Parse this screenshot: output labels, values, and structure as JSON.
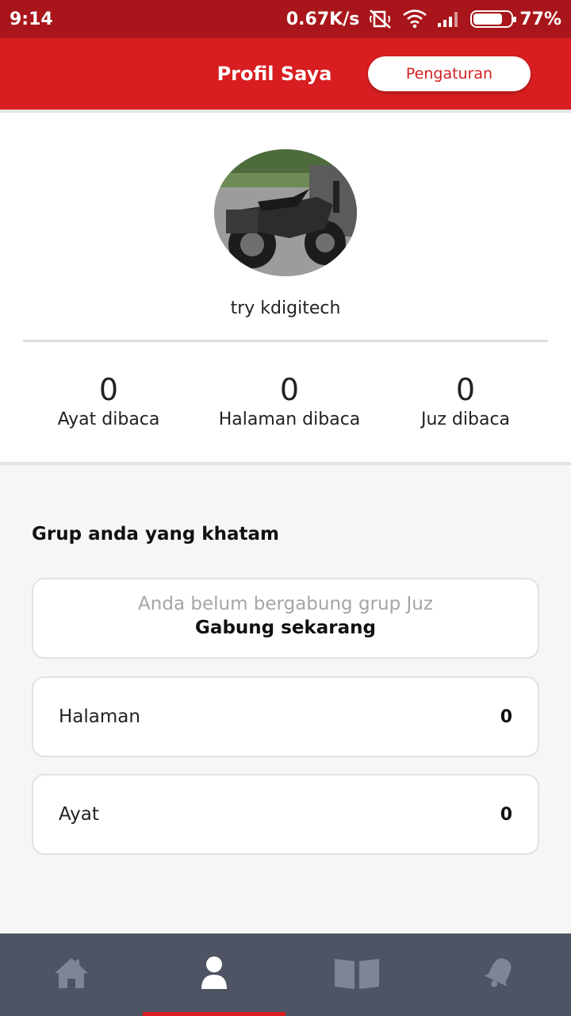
{
  "status_bar": {
    "time": "9:14",
    "speed": "0.67K/s",
    "battery": "77%",
    "battery_level": 0.77,
    "icons": [
      "mute-icon",
      "wifi-icon",
      "signal-icon",
      "battery-icon"
    ]
  },
  "header": {
    "title": "Profil Saya",
    "settings_label": "Pengaturan"
  },
  "profile": {
    "avatar_alt": "motorcycle",
    "username": "try kdigitech",
    "stats": [
      {
        "value": "0",
        "label": "Ayat dibaca"
      },
      {
        "value": "0",
        "label": "Halaman dibaca"
      },
      {
        "value": "0",
        "label": "Juz dibaca"
      }
    ]
  },
  "groups": {
    "title": "Grup anda yang khatam",
    "empty_text": "Anda belum bergabung grup Juz",
    "join_label": "Gabung sekarang",
    "rows": [
      {
        "label": "Halaman",
        "value": "0"
      },
      {
        "label": "Ayat",
        "value": "0"
      }
    ]
  },
  "nav": {
    "items": [
      {
        "icon": "home-icon",
        "active": false
      },
      {
        "icon": "profile-icon",
        "active": true
      },
      {
        "icon": "quran-book-icon",
        "active": false
      },
      {
        "icon": "notification-bell-icon",
        "active": false
      }
    ]
  },
  "colors": {
    "status_bar": "#a8161b",
    "app_bar": "#d81e20",
    "nav_bg": "#4e5463",
    "nav_icon": "#7d8597",
    "nav_icon_active": "#ffffff"
  }
}
